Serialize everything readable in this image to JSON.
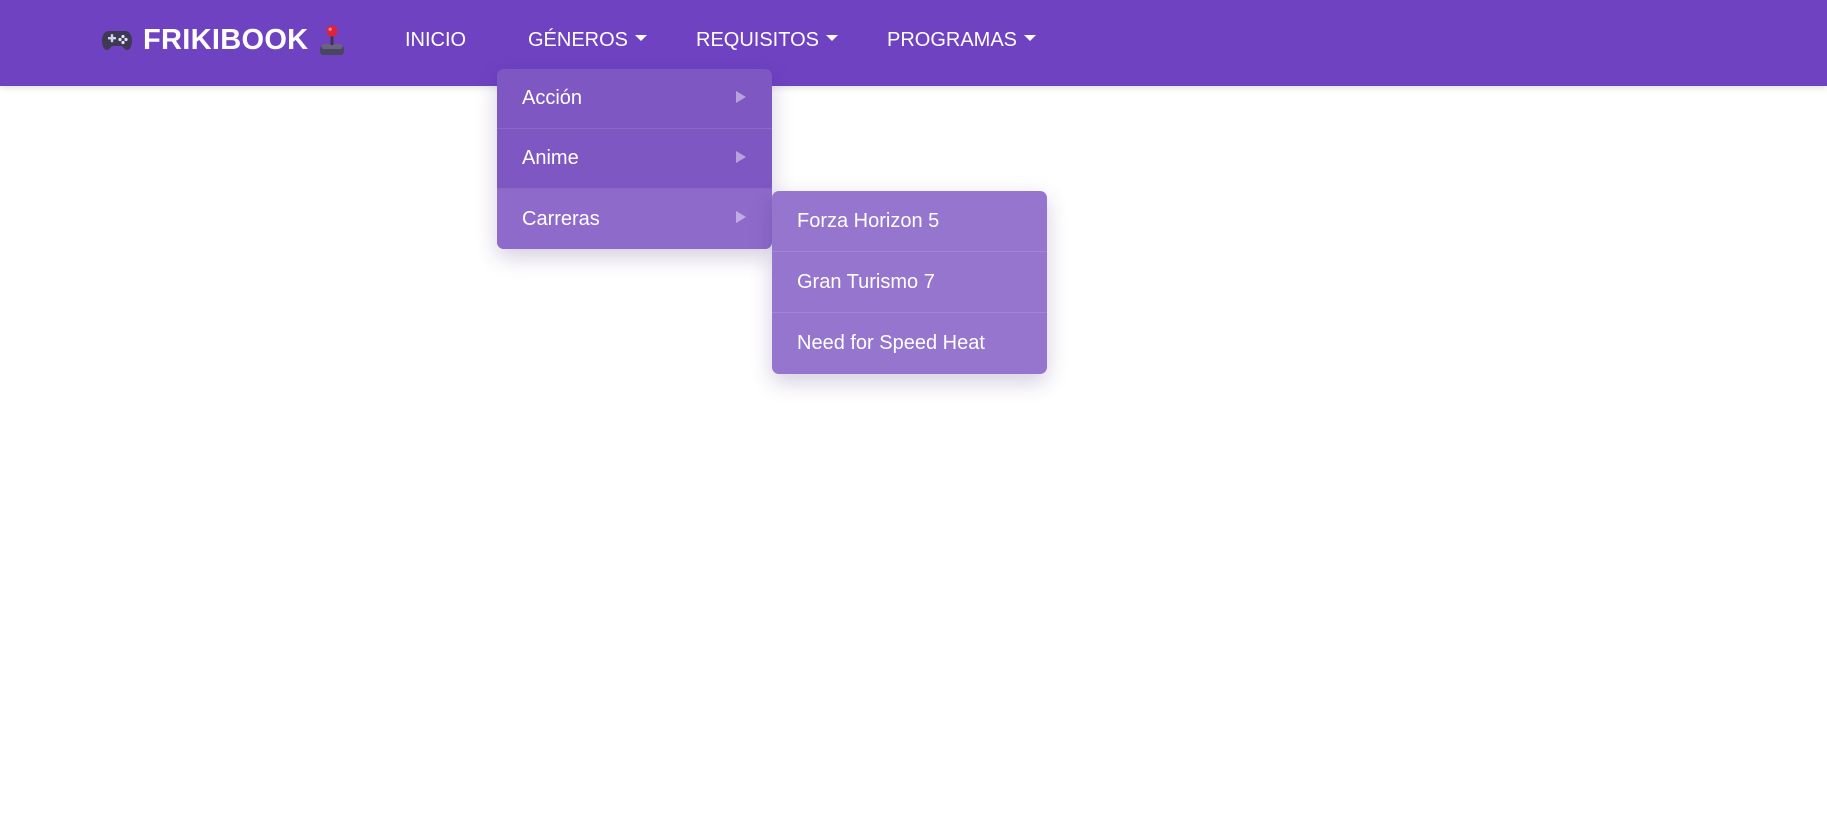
{
  "brand": {
    "name": "FRIKIBOOK",
    "left_icon": "gamepad-icon",
    "right_icon": "joystick-icon"
  },
  "nav": {
    "items": [
      {
        "label": "INICIO",
        "has_dropdown": false
      },
      {
        "label": "GÉNEROS",
        "has_dropdown": true
      },
      {
        "label": "REQUISITOS",
        "has_dropdown": true
      },
      {
        "label": "PROGRAMAS",
        "has_dropdown": true
      }
    ]
  },
  "genres_menu": {
    "items": [
      {
        "label": "Acción"
      },
      {
        "label": "Anime"
      },
      {
        "label": "Carreras"
      }
    ]
  },
  "carreras_submenu": {
    "items": [
      {
        "label": "Forza Horizon 5"
      },
      {
        "label": "Gran Turismo 7"
      },
      {
        "label": "Need for Speed Heat"
      }
    ]
  },
  "colors": {
    "navbar": "#6f42c1",
    "dropdown": "#7e57c2",
    "dropdown_hover": "#8e6bcb",
    "submenu": "#9575cd",
    "text": "#ffffff"
  }
}
